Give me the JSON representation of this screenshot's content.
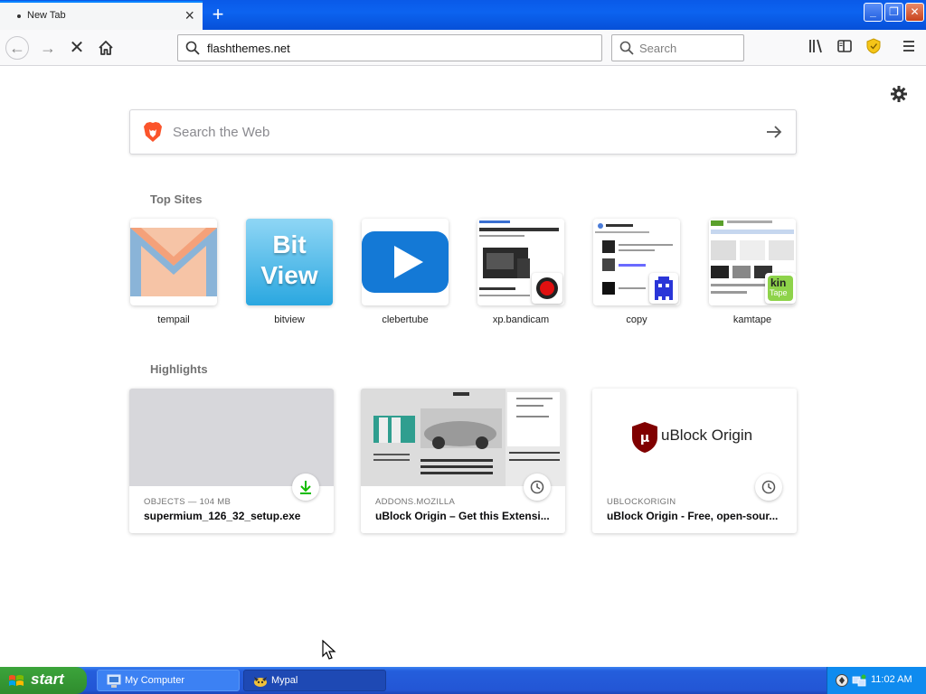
{
  "browser": {
    "tab": {
      "title": "New Tab"
    },
    "url": "flashthemes.net",
    "search_placeholder": "Search"
  },
  "newtab": {
    "search_placeholder": "Search the Web",
    "top_sites_title": "Top Sites",
    "top_sites": [
      {
        "label": "tempail"
      },
      {
        "label": "bitview",
        "thumb_text": "Bit View"
      },
      {
        "label": "clebertube"
      },
      {
        "label": "xp.bandicam"
      },
      {
        "label": "copy"
      },
      {
        "label": "kamtape"
      }
    ],
    "highlights_title": "Highlights",
    "highlights": [
      {
        "source": "OBJECTS — 104 MB",
        "title": "supermium_126_32_setup.exe",
        "badge": "download-icon"
      },
      {
        "source": "ADDONS.MOZILLA",
        "title": "uBlock Origin – Get this Extensi...",
        "badge": "clock-icon"
      },
      {
        "source": "UBLOCKORIGIN",
        "title": "uBlock Origin - Free, open-sour...",
        "badge": "clock-icon",
        "logo_text": "uBlock Origin"
      }
    ]
  },
  "taskbar": {
    "start_label": "start",
    "tasks": [
      {
        "label": "My Computer"
      },
      {
        "label": "Mypal"
      }
    ],
    "clock": "11:02 AM"
  },
  "colors": {
    "xp_blue": "#245edc",
    "start_green": "#3ca43b",
    "download_green": "#12bc00",
    "ublock_red": "#800000"
  }
}
